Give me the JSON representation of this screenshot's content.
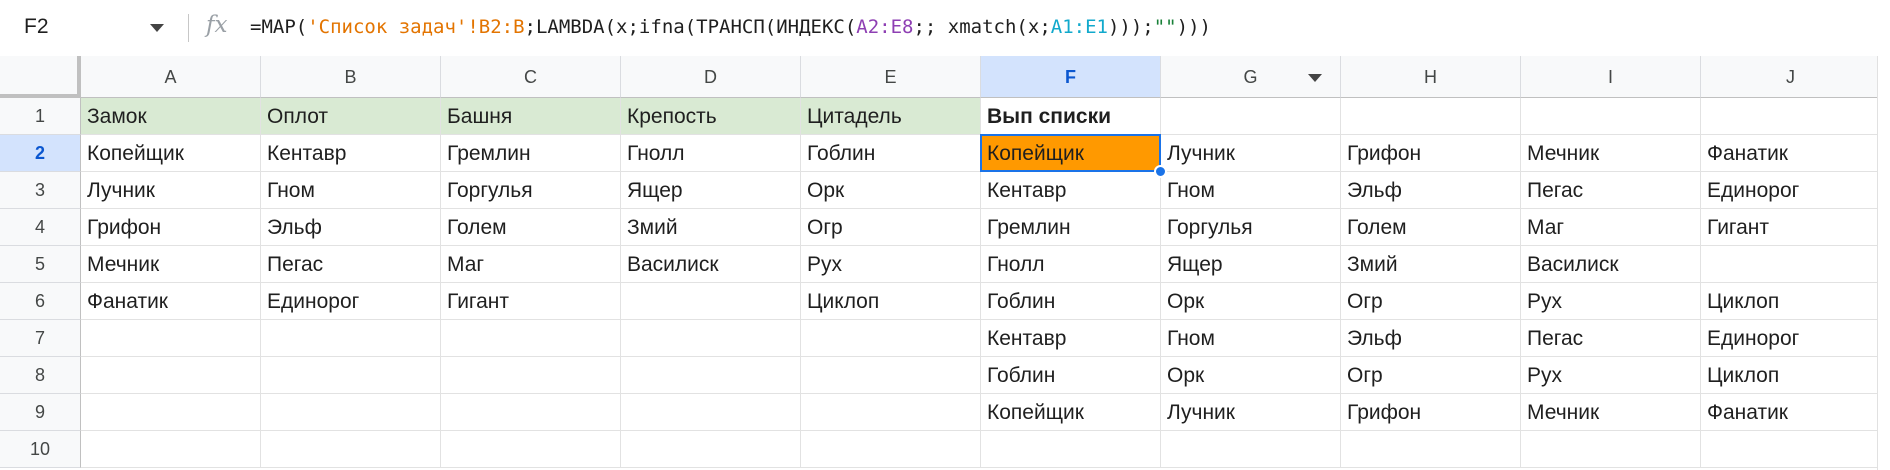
{
  "name_box": "F2",
  "formula": {
    "p1": "=MAP(",
    "p2": "'Список задач'!B2:B",
    "p3": ";LAMBDA(x;ifna(ТРАНСП(ИНДЕКС(",
    "p4": "A2:E8",
    "p5": ";; xmatch(x;",
    "p6": "A1:E1",
    "p7": ")));",
    "p8": "\"\"",
    "p9": ")))"
  },
  "columns": [
    "A",
    "B",
    "C",
    "D",
    "E",
    "F",
    "G",
    "H",
    "I",
    "J"
  ],
  "rows": [
    "1",
    "2",
    "3",
    "4",
    "5",
    "6",
    "7",
    "8",
    "9",
    "10"
  ],
  "cells": [
    [
      "Замок",
      "Оплот",
      "Башня",
      "Крепость",
      "Цитадель",
      "Вып списки",
      "",
      "",
      "",
      ""
    ],
    [
      "Копейщик",
      "Кентавр",
      "Гремлин",
      "Гнолл",
      "Гоблин",
      "Копейщик",
      "Лучник",
      "Грифон",
      "Мечник",
      "Фанатик"
    ],
    [
      "Лучник",
      "Гном",
      "Горгулья",
      "Ящер",
      "Орк",
      "Кентавр",
      "Гном",
      "Эльф",
      "Пегас",
      "Единорог"
    ],
    [
      "Грифон",
      "Эльф",
      "Голем",
      "Змий",
      "Огр",
      "Гремлин",
      "Горгулья",
      "Голем",
      "Маг",
      "Гигант"
    ],
    [
      "Мечник",
      "Пегас",
      "Маг",
      "Василиск",
      "Рух",
      "Гнолл",
      "Ящер",
      "Змий",
      "Василиск",
      ""
    ],
    [
      "Фанатик",
      "Единорог",
      "Гигант",
      "",
      "Циклоп",
      "Гоблин",
      "Орк",
      "Огр",
      "Рух",
      "Циклоп"
    ],
    [
      "",
      "",
      "",
      "",
      "",
      "Кентавр",
      "Гном",
      "Эльф",
      "Пегас",
      "Единорог"
    ],
    [
      "",
      "",
      "",
      "",
      "",
      "Гоблин",
      "Орк",
      "Огр",
      "Рух",
      "Циклоп"
    ],
    [
      "",
      "",
      "",
      "",
      "",
      "Копейщик",
      "Лучник",
      "Грифон",
      "Мечник",
      "Фанатик"
    ],
    [
      "",
      "",
      "",
      "",
      "",
      "",
      "",
      "",
      "",
      ""
    ]
  ],
  "colors": {
    "header_fill": "#d9ead3",
    "selected_fill": "#ff9900",
    "selection_accent": "#1a73e8"
  },
  "icons": [
    "chevron-down-icon",
    "fx-icon",
    "filter-dropdown-icon"
  ]
}
